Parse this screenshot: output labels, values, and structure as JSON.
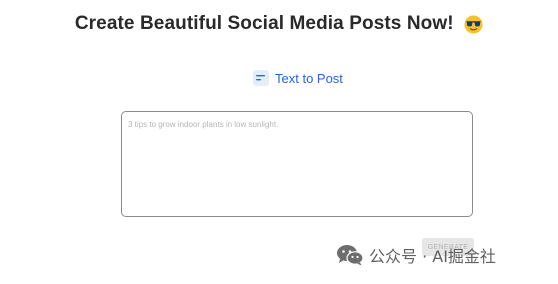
{
  "header": {
    "title": "Create Beautiful Social Media Posts Now!",
    "emoji_icon": "sunglasses-face-emoji-icon"
  },
  "mode_tab": {
    "icon": "text-lines-icon",
    "label": "Text to Post"
  },
  "prompt_input": {
    "value": "",
    "placeholder": "3 tips to grow indoor plants in low sunlight."
  },
  "generate_button": {
    "label": "GENERATE"
  },
  "watermark": {
    "icon": "wechat-icon",
    "text": "公众号 · AI掘金社"
  },
  "colors": {
    "accent": "#2563eb",
    "title_text": "#2a2a2a",
    "border": "#8b8b8b",
    "button_bg": "#e6e6e6",
    "button_text": "#b3b3b3"
  }
}
